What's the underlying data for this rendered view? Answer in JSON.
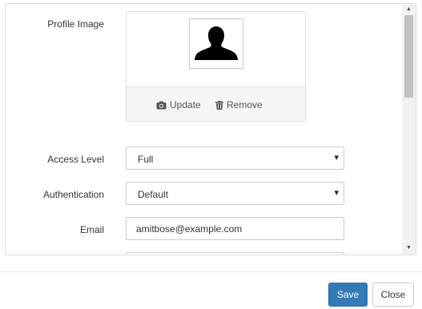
{
  "form": {
    "profile_image": {
      "label": "Profile Image",
      "update_label": "Update",
      "remove_label": "Remove"
    },
    "access_level": {
      "label": "Access Level",
      "value": "Full"
    },
    "authentication": {
      "label": "Authentication",
      "value": "Default"
    },
    "email": {
      "label": "Email",
      "value": "amitbose@example.com"
    }
  },
  "footer": {
    "save_label": "Save",
    "close_label": "Close"
  },
  "colors": {
    "primary": "#337ab7",
    "border": "#cccccc"
  },
  "icons": [
    "user-silhouette-icon",
    "camera-icon",
    "trash-icon",
    "caret-down-icon",
    "scroll-up-icon",
    "scroll-down-icon"
  ]
}
